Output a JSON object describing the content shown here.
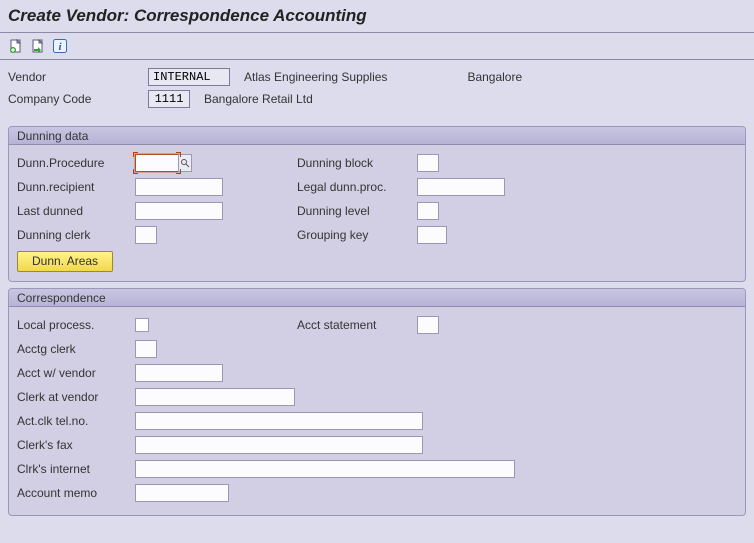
{
  "title": "Create Vendor: Correspondence Accounting",
  "header": {
    "vendor_label": "Vendor",
    "vendor_code": "INTERNAL",
    "vendor_name": "Atlas Engineering Supplies",
    "vendor_city": "Bangalore",
    "company_label": "Company Code",
    "company_code": "1111",
    "company_name": "Bangalore Retail Ltd"
  },
  "panels": {
    "dunning": {
      "title": "Dunning data",
      "dunn_procedure_label": "Dunn.Procedure",
      "dunn_recipient_label": "Dunn.recipient",
      "last_dunned_label": "Last dunned",
      "dunning_clerk_label": "Dunning clerk",
      "dunning_block_label": "Dunning block",
      "legal_dunn_proc_label": "Legal dunn.proc.",
      "dunning_level_label": "Dunning level",
      "grouping_key_label": "Grouping key",
      "dunn_areas_btn": "Dunn. Areas"
    },
    "correspondence": {
      "title": "Correspondence",
      "local_process_label": "Local process.",
      "acct_statement_label": "Acct statement",
      "acctg_clerk_label": "Acctg clerk",
      "acct_w_vendor_label": "Acct w/ vendor",
      "clerk_at_vendor_label": "Clerk at vendor",
      "act_clk_tel_label": "Act.clk tel.no.",
      "clerks_fax_label": "Clerk's fax",
      "clrks_internet_label": "Clrk's internet",
      "account_memo_label": "Account memo"
    }
  }
}
